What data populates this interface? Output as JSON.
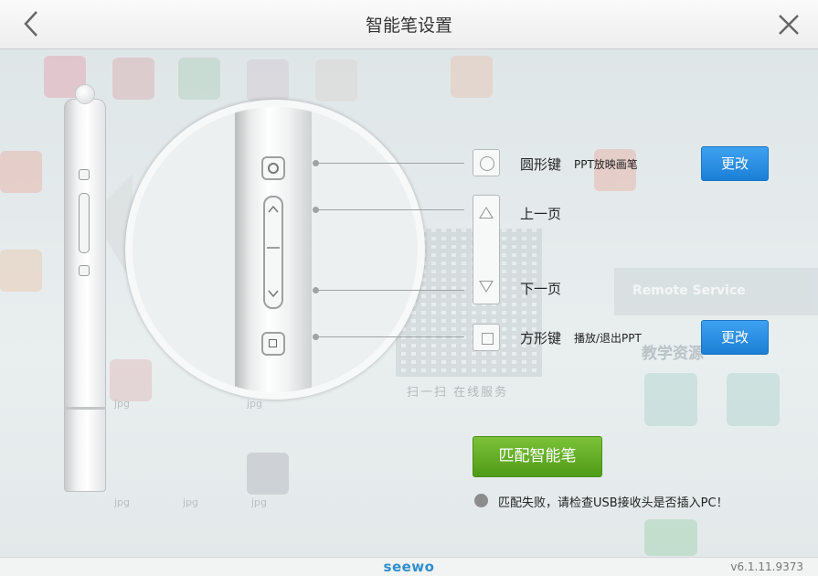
{
  "window": {
    "title": "智能笔设置"
  },
  "keys": [
    {
      "id": "circle",
      "label": "圆形键",
      "function": "PPT放映画笔",
      "button": "更改"
    },
    {
      "id": "up",
      "label": "上一页"
    },
    {
      "id": "down",
      "label": "下一页"
    },
    {
      "id": "square",
      "label": "方形键",
      "function": "播放/退出PPT",
      "button": "更改"
    }
  ],
  "pairing": {
    "button": "匹配智能笔",
    "status": "匹配失败，请检查USB接收头是否插入PC！",
    "status_color": "#8c8c8c"
  },
  "background": {
    "qr_caption": "扫一扫 在线服务",
    "remote_service": "Remote Service",
    "section_label": "教学资源"
  },
  "footer": {
    "brand": "seewo",
    "version": "v6.1.11.9373"
  },
  "colors": {
    "change_button": "#1b7fd6",
    "pair_button": "#4f9b16",
    "brand": "#2f8fce"
  }
}
